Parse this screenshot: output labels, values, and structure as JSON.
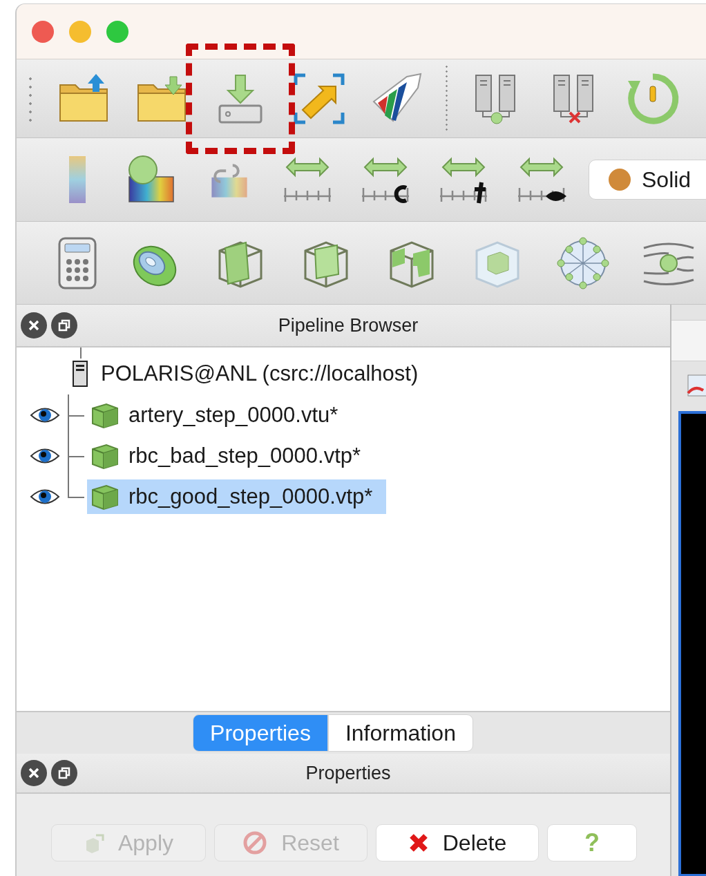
{
  "toolbar_main": {
    "items": [
      {
        "highlighted": false
      },
      {
        "highlighted": false
      },
      {
        "highlighted": true
      },
      {
        "highlighted": false
      },
      {
        "highlighted": false
      },
      {
        "highlighted": false
      },
      {
        "highlighted": false
      },
      {
        "highlighted": false
      }
    ]
  },
  "toolbar_color": {
    "representation": {
      "label": "Solid"
    }
  },
  "pipeline_browser": {
    "title": "Pipeline Browser",
    "server": {
      "label": "POLARIS@ANL (csrc://localhost)",
      "children": [
        {
          "label": "artery_step_0000.vtu*",
          "visible": true,
          "selected": false
        },
        {
          "label": "rbc_bad_step_0000.vtp*",
          "visible": true,
          "selected": false
        },
        {
          "label": "rbc_good_step_0000.vtp*",
          "visible": true,
          "selected": true
        }
      ]
    }
  },
  "tabs": [
    {
      "label": "Properties",
      "selected": true
    },
    {
      "label": "Information",
      "selected": false
    }
  ],
  "properties_panel": {
    "title": "Properties",
    "buttons": [
      {
        "label": "Apply",
        "kind": "apply",
        "disabled": true
      },
      {
        "label": "Reset",
        "kind": "reset",
        "disabled": true
      },
      {
        "label": "Delete",
        "kind": "delete",
        "disabled": false
      },
      {
        "label": "?",
        "kind": "help",
        "disabled": false
      }
    ]
  }
}
